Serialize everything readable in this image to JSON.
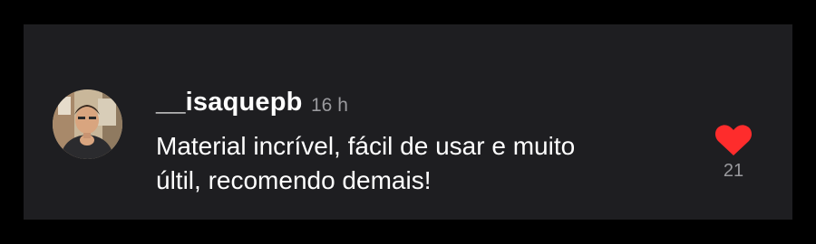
{
  "comment": {
    "username": "__isaquepb",
    "timestamp": "16 h",
    "text_lines": [
      "Material incrível, fácil de usar e muito",
      "últil, recomendo demais!"
    ],
    "likes": "21",
    "liked": true
  },
  "icons": {
    "avatar": "profile-photo",
    "like": "heart-icon"
  },
  "colors": {
    "background": "#000000",
    "card": "#1e1e21",
    "text": "#ffffff",
    "muted": "#9a9a9e",
    "heart": "#fe2c2c"
  }
}
